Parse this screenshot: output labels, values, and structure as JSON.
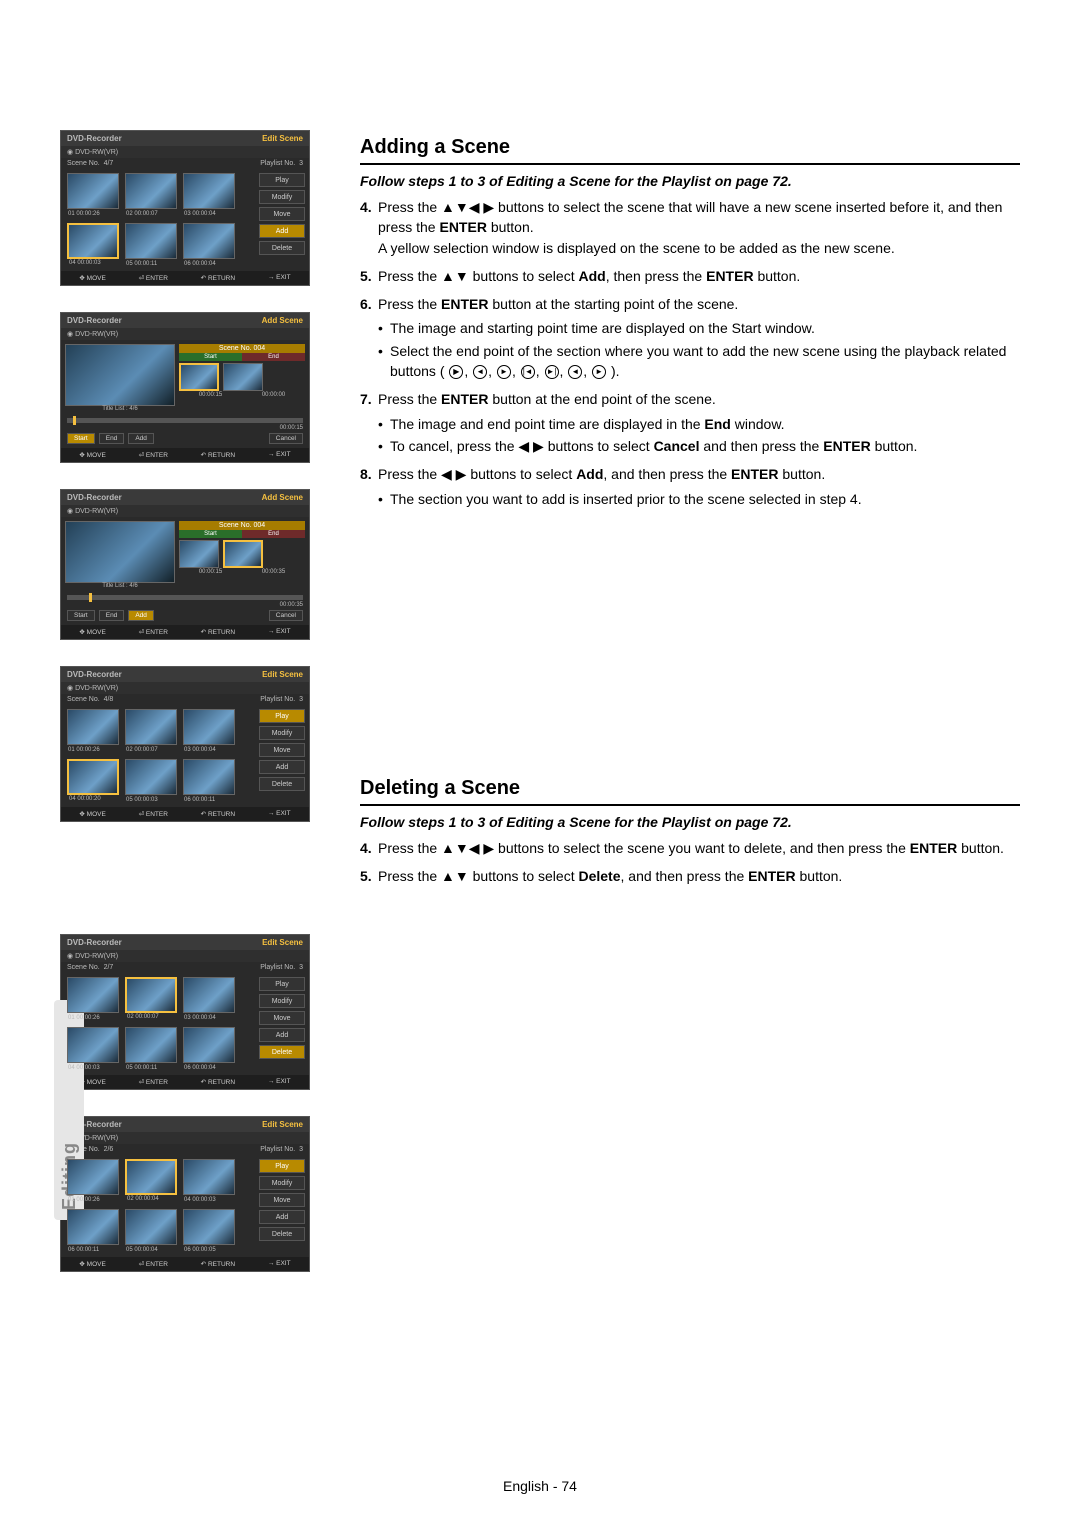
{
  "side_tab": "Editing",
  "footer": {
    "lang": "English",
    "page": "74"
  },
  "panel_common": {
    "title": "DVD-Recorder",
    "sub": "DVD-RW(VR)",
    "move": "MOVE",
    "enter": "ENTER",
    "return": "RETURN",
    "exit": "EXIT"
  },
  "modes": {
    "edit": "Edit Scene",
    "add": "Add Scene"
  },
  "menus": {
    "play": "Play",
    "modify": "Modify",
    "move": "Move",
    "add": "Add",
    "delete": "Delete",
    "cancel": "Cancel",
    "start": "Start",
    "end": "End"
  },
  "labels": {
    "scene_no": "Scene No.",
    "playlist_no": "Playlist No.",
    "title_list": "Title List : 4/6",
    "scene_bar": "Scene No. 004"
  },
  "panel1": {
    "count": "4/7",
    "pl": "3",
    "t": [
      {
        "n": "01",
        "t": "00:00:26"
      },
      {
        "n": "02",
        "t": "00:00:07"
      },
      {
        "n": "03",
        "t": "00:00:04"
      },
      {
        "n": "04",
        "t": "00:00:03"
      },
      {
        "n": "05",
        "t": "00:00:11"
      },
      {
        "n": "06",
        "t": "00:00:04"
      }
    ]
  },
  "panel2": {
    "start_t": "00:00:15",
    "end_t": "00:00:00",
    "track_t": "00:00:15"
  },
  "panel3": {
    "start_t": "00:00:15",
    "end_t": "00:00:35",
    "track_t": "00:00:35"
  },
  "panel4": {
    "count": "4/8",
    "pl": "3",
    "t": [
      {
        "n": "01",
        "t": "00:00:26"
      },
      {
        "n": "02",
        "t": "00:00:07"
      },
      {
        "n": "03",
        "t": "00:00:04"
      },
      {
        "n": "04",
        "t": "00:00:20"
      },
      {
        "n": "05",
        "t": "00:00:03"
      },
      {
        "n": "06",
        "t": "00:00:11"
      }
    ]
  },
  "panel5": {
    "count": "2/7",
    "pl": "3",
    "t": [
      {
        "n": "01",
        "t": "00:00:26"
      },
      {
        "n": "02",
        "t": "00:00:07"
      },
      {
        "n": "03",
        "t": "00:00:04"
      },
      {
        "n": "04",
        "t": "00:00:03"
      },
      {
        "n": "05",
        "t": "00:00:11"
      },
      {
        "n": "06",
        "t": "00:00:04"
      }
    ]
  },
  "panel6": {
    "count": "2/6",
    "pl": "3",
    "t": [
      {
        "n": "01",
        "t": "00:00:26"
      },
      {
        "n": "02",
        "t": "00:00:04"
      },
      {
        "n": "04",
        "t": "00:00:03"
      },
      {
        "n": "06",
        "t": "00:00:11"
      },
      {
        "n": "05",
        "t": "00:00:04"
      },
      {
        "n": "06",
        "t": "00:00:05"
      }
    ]
  },
  "section1": {
    "title": "Adding a Scene",
    "intro": "Follow steps 1 to 3 of Editing a Scene for the Playlist on page 72.",
    "s4a": "Press the ▲▼◀ ▶ buttons to select the scene that will have a new scene inserted before it, and then press the ",
    "s4b": " button.",
    "s4c": "A yellow selection window is displayed on the scene to be added as the new scene.",
    "s5a": "Press the ▲▼ buttons to select ",
    "s5b": ", then press the ",
    "s5c": " button.",
    "s6a": "Press the ",
    "s6b": " button at the starting point of the scene.",
    "s6_b1": "The image and starting point time are displayed on the Start window.",
    "s6_b2a": "Select the end point of the section where you want to add the new scene using the playback related buttons ( ",
    "s6_b2b": " ).",
    "s7a": "Press the ",
    "s7b": " button at the end point of the scene.",
    "s7_b1a": "The image and end point time are displayed in the ",
    "s7_b1b": " window.",
    "s7_b2a": "To cancel, press the ◀ ▶ buttons to select ",
    "s7_b2b": " and then press the ",
    "s7_b2c": " button.",
    "s8a": "Press the ◀ ▶ buttons to select ",
    "s8b": ", and then press the ",
    "s8c": " button.",
    "s8_b1": "The section you want to add is inserted prior to the scene selected in step 4."
  },
  "section2": {
    "title": "Deleting a Scene",
    "intro": "Follow steps 1 to 3 of Editing a Scene for the Playlist on page 72.",
    "s4a": "Press the ▲▼◀ ▶ buttons to select the scene you want to delete, and then press the ",
    "s4b": " button.",
    "s5a": "Press the ▲▼ buttons to select ",
    "s5b": ", and then press the ",
    "s5c": " button."
  },
  "bold": {
    "enter": "ENTER",
    "add": "Add",
    "end": "End",
    "cancel": "Cancel",
    "delete": "Delete"
  }
}
